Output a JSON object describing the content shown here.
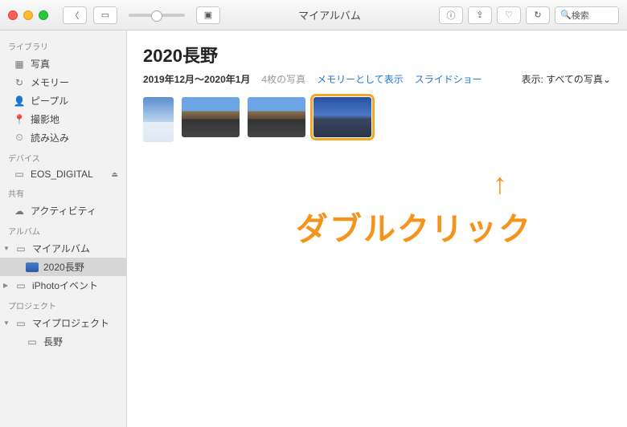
{
  "window": {
    "title": "マイアルバム",
    "search_placeholder": "検索"
  },
  "sidebar": {
    "sections": {
      "library": {
        "header": "ライブラリ",
        "items": [
          "写真",
          "メモリー",
          "ピープル",
          "撮影地",
          "読み込み"
        ]
      },
      "devices": {
        "header": "デバイス",
        "items": [
          "EOS_DIGITAL"
        ]
      },
      "shared": {
        "header": "共有",
        "items": [
          "アクティビティ"
        ]
      },
      "albums": {
        "header": "アルバム",
        "items": [
          "マイアルバム",
          "2020長野",
          "iPhotoイベント"
        ]
      },
      "projects": {
        "header": "プロジェクト",
        "items": [
          "マイプロジェクト",
          "長野"
        ]
      }
    }
  },
  "content": {
    "title": "2020長野",
    "date_range": "2019年12月〜2020年1月",
    "count": "4枚の写真",
    "link_memory": "メモリーとして表示",
    "link_slideshow": "スライドショー",
    "display_label": "表示: すべての写真",
    "display_chevron": "⌄"
  },
  "annotation": {
    "arrow": "↑",
    "text": "ダブルクリック"
  }
}
